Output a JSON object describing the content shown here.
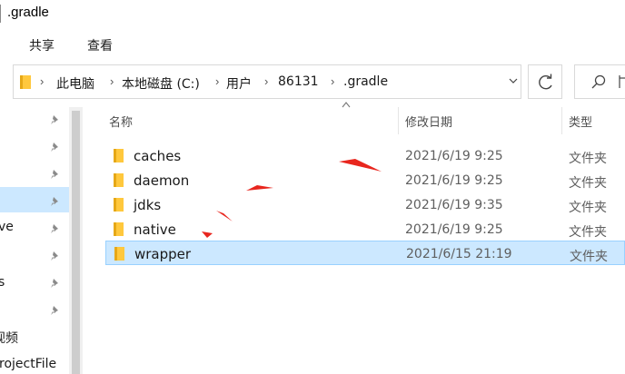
{
  "window": {
    "title": ".gradle"
  },
  "ribbon": {
    "tabs": [
      "共享",
      "查看"
    ]
  },
  "addressbar": {
    "crumbs": [
      "此电脑",
      "本地磁盘 (C:)",
      "用户",
      "86131",
      ".gradle"
    ],
    "separator": "›",
    "dropdown_icon": "chevron-down-icon"
  },
  "navpane": {
    "items": [
      "ve",
      "s",
      "视频",
      "rojectFile"
    ]
  },
  "columns": {
    "name": "名称",
    "modified": "修改日期",
    "type": "类型"
  },
  "files": [
    {
      "name": "caches",
      "modified": "2021/6/19 9:25",
      "type": "文件夹"
    },
    {
      "name": "daemon",
      "modified": "2021/6/19 9:25",
      "type": "文件夹"
    },
    {
      "name": "jdks",
      "modified": "2021/6/19 9:35",
      "type": "文件夹"
    },
    {
      "name": "native",
      "modified": "2021/6/19 9:25",
      "type": "文件夹"
    },
    {
      "name": "wrapper",
      "modified": "2021/6/15 21:19",
      "type": "文件夹"
    }
  ],
  "selected_file": "wrapper",
  "colors": {
    "selection_bg": "#cce8ff",
    "selection_border": "#99d1ff",
    "folder_yellow": "#ffc83d",
    "annotation_red": "#e8261e"
  }
}
